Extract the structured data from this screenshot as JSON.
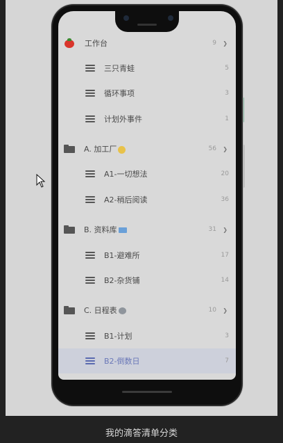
{
  "caption": "我的滴答清单分类",
  "lists": [
    {
      "type": "group",
      "icon": "tomato-icon",
      "label": "工作台",
      "count": "9",
      "expanded": true
    },
    {
      "type": "item",
      "label": "三只青蛙",
      "count": "5"
    },
    {
      "type": "item",
      "label": "循环事项",
      "count": "3"
    },
    {
      "type": "item",
      "label": "计划外事件",
      "count": "1"
    },
    {
      "type": "group",
      "icon": "folder-icon",
      "label": "A. 加工厂",
      "emoji": "smile",
      "count": "56",
      "expanded": true
    },
    {
      "type": "item",
      "label": "A1-一切想法",
      "count": "20"
    },
    {
      "type": "item",
      "label": "A2-稍后阅读",
      "count": "36"
    },
    {
      "type": "group",
      "icon": "folder-icon",
      "label": "B. 资料库",
      "emoji": "memo",
      "count": "31",
      "expanded": true
    },
    {
      "type": "item",
      "label": "B1-避难所",
      "count": "17"
    },
    {
      "type": "item",
      "label": "B2-杂货铺",
      "count": "14"
    },
    {
      "type": "group",
      "icon": "folder-icon",
      "label": "C. 日程表",
      "emoji": "koala",
      "count": "10",
      "expanded": true
    },
    {
      "type": "item",
      "label": "B1-计划",
      "count": "3"
    },
    {
      "type": "item",
      "label": "B2-倒数日",
      "count": "7",
      "selected": true
    }
  ],
  "colors": {
    "selected_bg": "#cdd0db",
    "selected_accent": "#5a6ab0",
    "tomato": "#d9352b"
  }
}
